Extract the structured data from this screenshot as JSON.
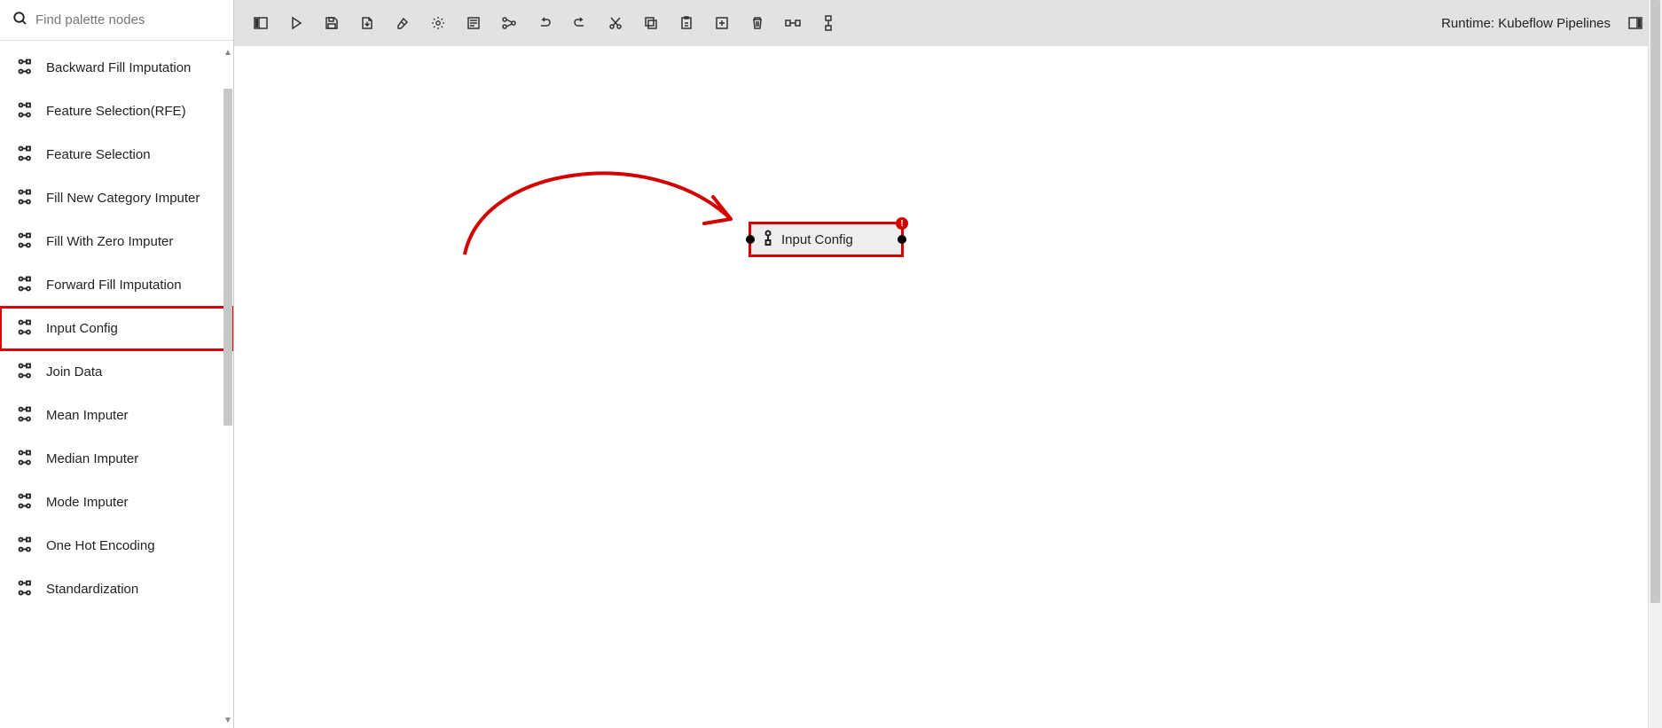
{
  "search": {
    "placeholder": "Find palette nodes"
  },
  "palette": {
    "items": [
      {
        "label": "Backward Fill Imputation"
      },
      {
        "label": "Feature Selection(RFE)"
      },
      {
        "label": "Feature Selection"
      },
      {
        "label": "Fill New Category Imputer"
      },
      {
        "label": "Fill With Zero Imputer"
      },
      {
        "label": "Forward Fill Imputation"
      },
      {
        "label": "Input Config"
      },
      {
        "label": "Join Data"
      },
      {
        "label": "Mean Imputer"
      },
      {
        "label": "Median Imputer"
      },
      {
        "label": "Mode Imputer"
      },
      {
        "label": "One Hot Encoding"
      },
      {
        "label": "Standardization"
      }
    ],
    "highlighted_index": 6
  },
  "toolbar": {
    "runtime_label": "Runtime: Kubeflow Pipelines",
    "buttons": [
      "panel-toggle-left",
      "run",
      "save",
      "export",
      "clear",
      "settings-gear",
      "comment",
      "nodes-view",
      "undo",
      "redo",
      "cut",
      "copy",
      "paste",
      "add",
      "delete",
      "arrange-horizontal",
      "arrange-vertical"
    ],
    "right_button": "panel-toggle-right"
  },
  "canvas": {
    "node": {
      "label": "Input Config",
      "has_error": true
    }
  }
}
